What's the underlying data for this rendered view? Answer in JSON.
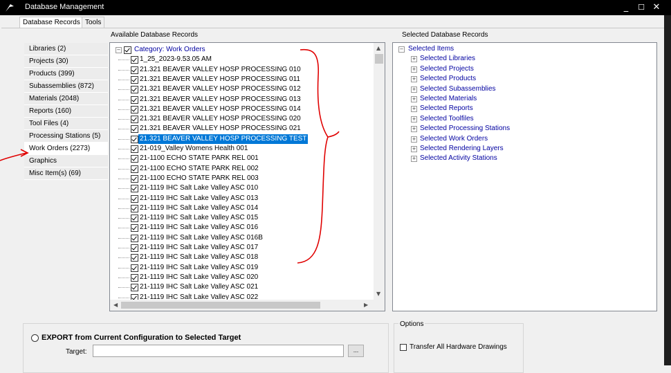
{
  "window": {
    "title": "Database Management",
    "minimize": "_",
    "maximize": "☐",
    "close": "✕"
  },
  "tabs": [
    {
      "label": "Database Records"
    },
    {
      "label": "Tools"
    }
  ],
  "available_label": "Available Database Records",
  "selected_label": "Selected Database Records",
  "sidebar": {
    "items": [
      {
        "label": "Libraries (2)"
      },
      {
        "label": "Projects (30)"
      },
      {
        "label": "Products (399)"
      },
      {
        "label": "Subassemblies (872)"
      },
      {
        "label": "Materials (2048)"
      },
      {
        "label": "Reports (160)"
      },
      {
        "label": "Tool Files (4)"
      },
      {
        "label": "Processing Stations (5)"
      },
      {
        "label": "Work Orders (2273)"
      },
      {
        "label": "Graphics"
      },
      {
        "label": "Misc Item(s) (69)"
      }
    ]
  },
  "available_tree": {
    "category": "Category: Work Orders",
    "items": [
      "1_25_2023-9.53.05 AM",
      "21.321 BEAVER VALLEY HOSP PROCESSING 010",
      "21.321 BEAVER VALLEY HOSP PROCESSING 011",
      "21.321 BEAVER VALLEY HOSP PROCESSING 012",
      "21.321 BEAVER VALLEY HOSP PROCESSING 013",
      "21.321 BEAVER VALLEY HOSP PROCESSING 014",
      "21.321 BEAVER VALLEY HOSP PROCESSING 020",
      "21.321 BEAVER VALLEY HOSP PROCESSING 021",
      "21.321 BEAVER VALLEY HOSP PROCESSING TEST",
      "21-019_Valley Womens Health 001",
      "21-1100 ECHO STATE PARK REL 001",
      "21-1100 ECHO STATE PARK REL 002",
      "21-1100 ECHO STATE PARK REL 003",
      "21-1119 IHC Salt Lake Valley ASC 010",
      "21-1119 IHC Salt Lake Valley ASC 013",
      "21-1119 IHC Salt Lake Valley ASC 014",
      "21-1119 IHC Salt Lake Valley ASC 015",
      "21-1119 IHC Salt Lake Valley ASC 016",
      "21-1119 IHC Salt Lake Valley ASC 016B",
      "21-1119 IHC Salt Lake Valley ASC 017",
      "21-1119 IHC Salt Lake Valley ASC 018",
      "21-1119 IHC Salt Lake Valley ASC 019",
      "21-1119 IHC Salt Lake Valley ASC 020",
      "21-1119 IHC Salt Lake Valley ASC 021",
      "21-1119 IHC Salt Lake Valley ASC 022"
    ]
  },
  "selected_tree": {
    "root": "Selected Items",
    "items": [
      "Selected Libraries",
      "Selected Projects",
      "Selected Products",
      "Selected Subassemblies",
      "Selected Materials",
      "Selected Reports",
      "Selected Toolfiles",
      "Selected Processing Stations",
      "Selected Work Orders",
      "Selected Rendering Layers",
      "Selected Activity Stations"
    ]
  },
  "export": {
    "label": "EXPORT from Current Configuration to Selected Target",
    "target_label": "Target:",
    "target_value": "",
    "browse": "..."
  },
  "options": {
    "label": "Options",
    "transfer_hardware": "Transfer All Hardware Drawings"
  },
  "colors": {
    "selection": "#0078d7",
    "tree_link": "#0000a0",
    "annotation": "#e00000"
  }
}
